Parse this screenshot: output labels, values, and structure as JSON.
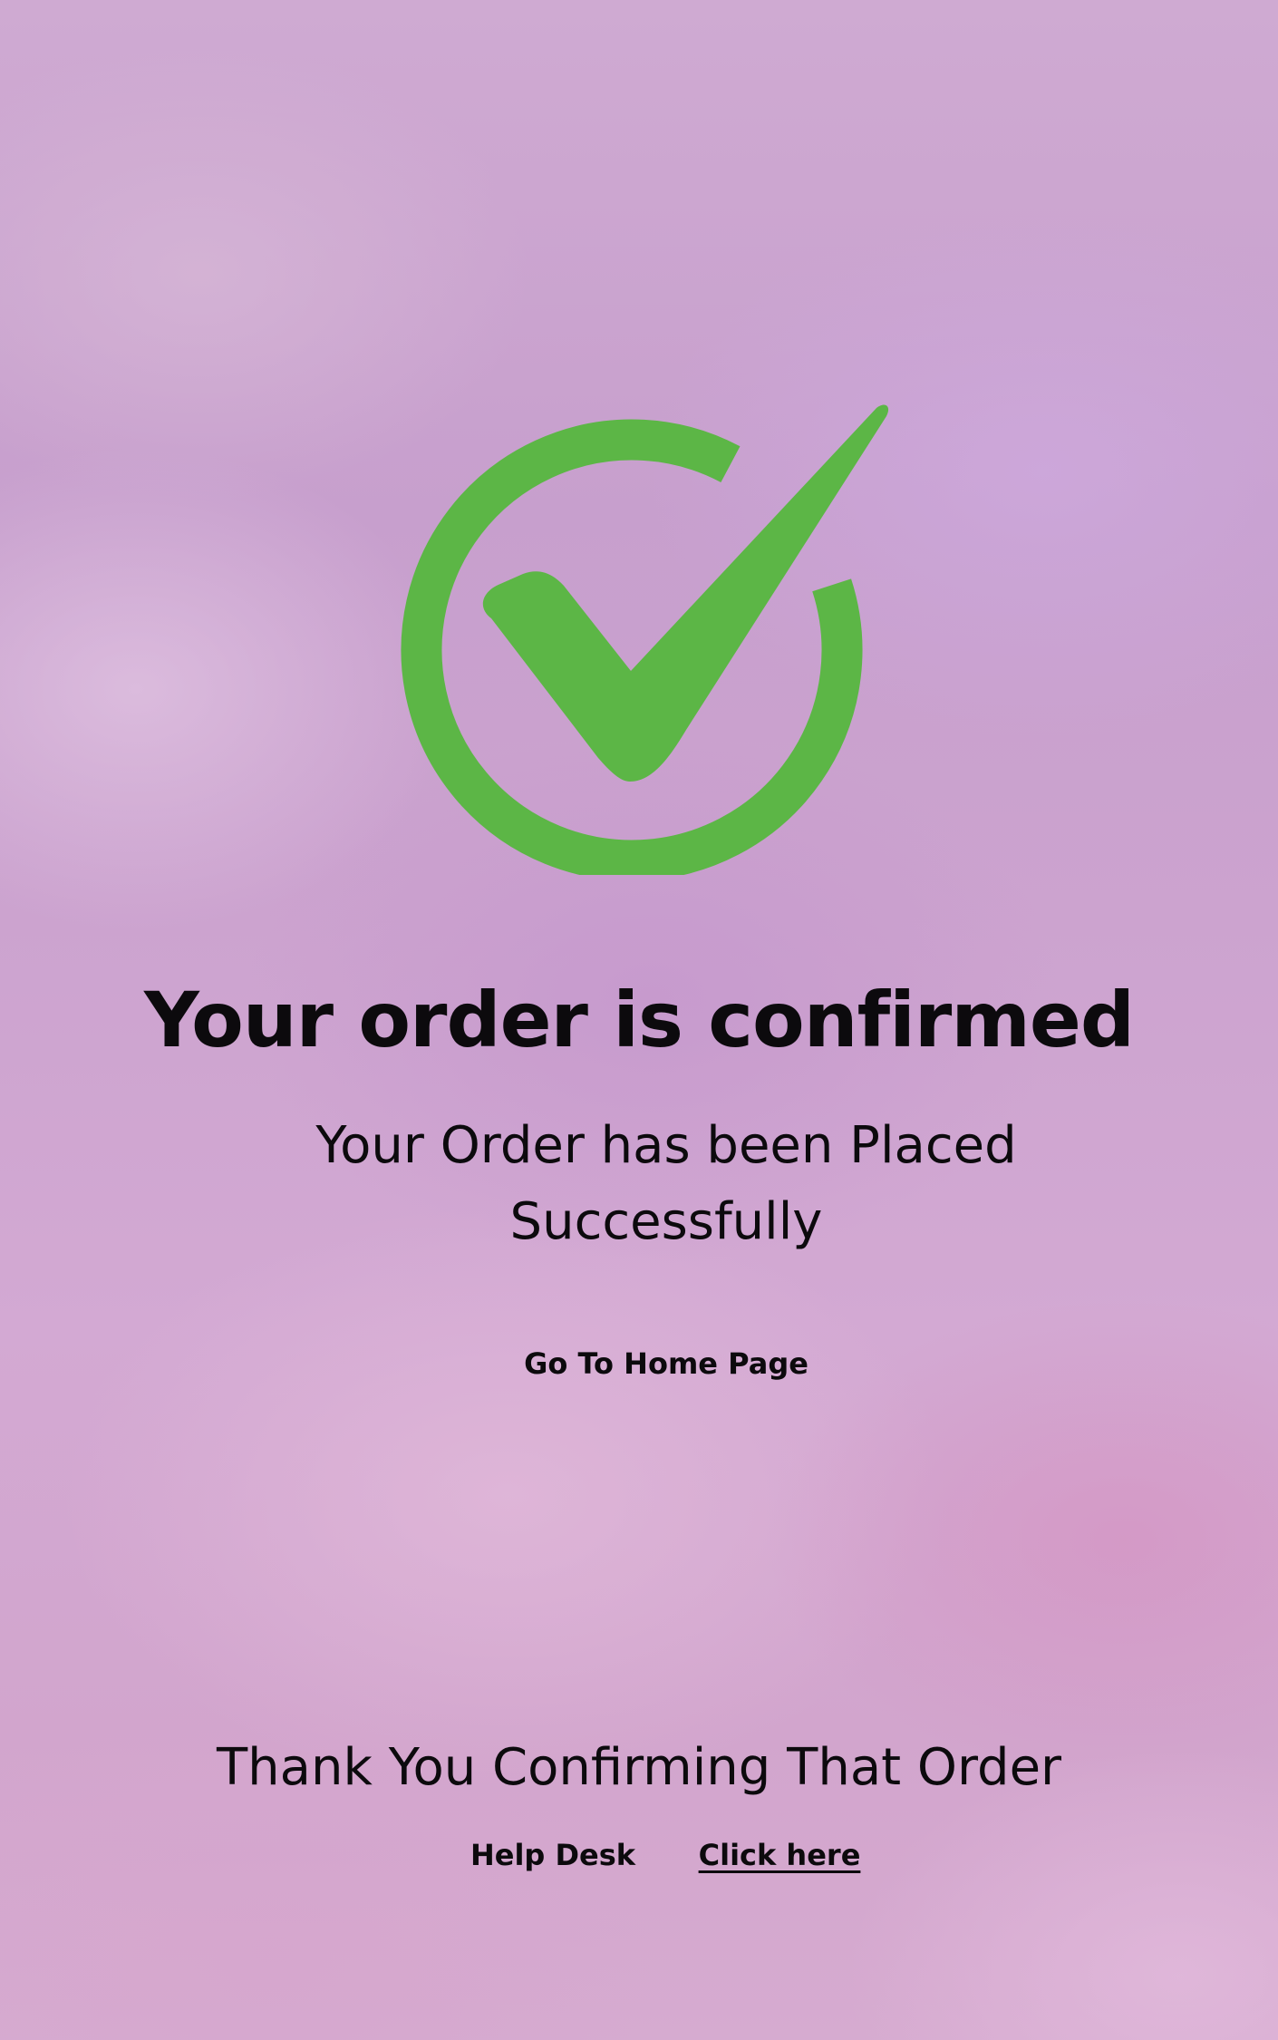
{
  "confirmation": {
    "icon": "check-circle-icon",
    "icon_color": "#5cb646",
    "title": "Your order is confirmed",
    "subtitle": "Your Order has been Placed Successfully",
    "home_link_label": "Go To Home Page"
  },
  "footer": {
    "thanks_text": "Thank You Confirming That Order",
    "help_label": "Help Desk",
    "help_link_label": "Click here"
  }
}
